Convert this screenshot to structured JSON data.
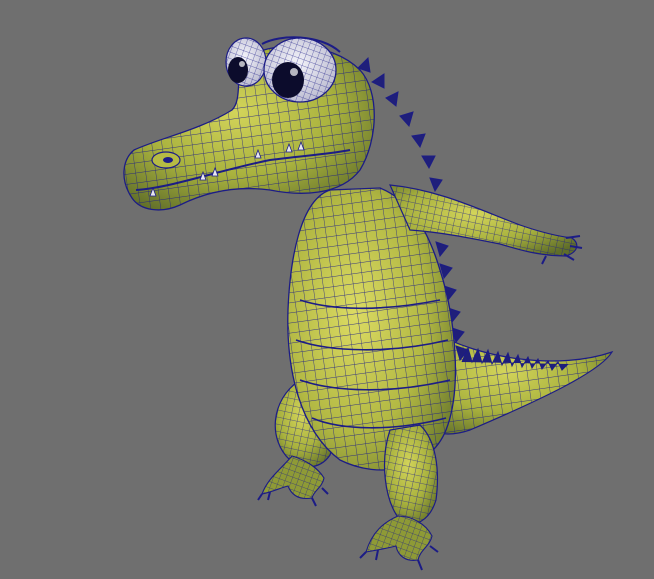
{
  "viewport": {
    "background": "#6f6f6f",
    "wire_color": "#1c1c86",
    "skin_light": "#c6c84a",
    "skin_mid": "#9aa43a",
    "skin_dark": "#5b6a28",
    "eye_white": "#e9e9f2",
    "pupil": "#0c0c2c",
    "spike_color": "#1f1f7a"
  },
  "subject": {
    "icon": "crocodile-character-icon"
  }
}
